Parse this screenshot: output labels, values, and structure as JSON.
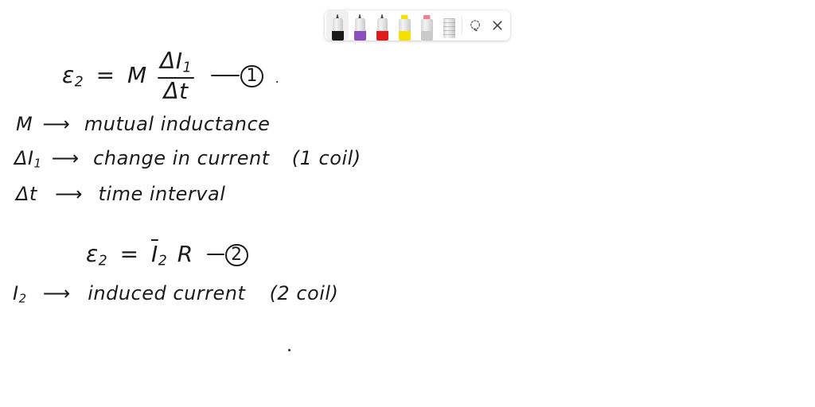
{
  "app": {
    "surface": "handwritten-note-canvas",
    "background_color": "#ffffff",
    "ink_color": "#1b1b1b"
  },
  "toolbar": {
    "name": "annotation-toolbar",
    "tools": [
      {
        "id": "pen-black",
        "label": "Black pen",
        "type": "pen",
        "color": "#1a1a1a",
        "selected": true
      },
      {
        "id": "pen-purple",
        "label": "Purple pen",
        "type": "pen",
        "color": "#8b4fc0",
        "selected": false
      },
      {
        "id": "pen-red",
        "label": "Red pen",
        "type": "pen",
        "color": "#e01b1b",
        "selected": false
      },
      {
        "id": "highlighter-yellow",
        "label": "Yellow highlighter",
        "type": "highlighter",
        "color": "#f7e000",
        "selected": false
      },
      {
        "id": "highlighter-pink",
        "label": "Pink highlighter",
        "type": "highlighter",
        "color": "#f08098",
        "selected": false
      },
      {
        "id": "eraser",
        "label": "Eraser",
        "type": "eraser",
        "color": "#d8d8d8",
        "selected": false
      }
    ],
    "actions": [
      {
        "id": "lasso-select",
        "label": "Lasso select",
        "icon": "lasso-select-icon"
      },
      {
        "id": "close",
        "label": "Close",
        "icon": "close-icon"
      }
    ]
  },
  "note": {
    "equation_1": {
      "lhs": "ε",
      "lhs_sub": "2",
      "equals": "=",
      "coefficient": "M",
      "numerator": "ΔI",
      "numerator_sub": "1",
      "denominator": "Δt",
      "tag": "1",
      "trailing_dot": "."
    },
    "definitions_1": [
      {
        "symbol": "M",
        "symbol_sub": "",
        "arrow": "⟶",
        "text": "mutual inductance",
        "note": ""
      },
      {
        "symbol": "ΔI",
        "symbol_sub": "1",
        "arrow": "⟶",
        "text": "change in current",
        "note": "(1 coil)"
      },
      {
        "symbol": "Δt",
        "symbol_sub": "",
        "arrow": "⟶",
        "text": "time interval",
        "note": ""
      }
    ],
    "equation_2": {
      "lhs": "ε",
      "lhs_sub": "2",
      "equals": "=",
      "rhs": "I",
      "rhs_sub": "2",
      "rhs_tail": "R",
      "tag": "2"
    },
    "definitions_2": [
      {
        "symbol": "I",
        "symbol_sub": "2",
        "arrow": "⟶",
        "text": "induced current",
        "note": "(2 coil)"
      }
    ],
    "stray_mark": "·"
  }
}
